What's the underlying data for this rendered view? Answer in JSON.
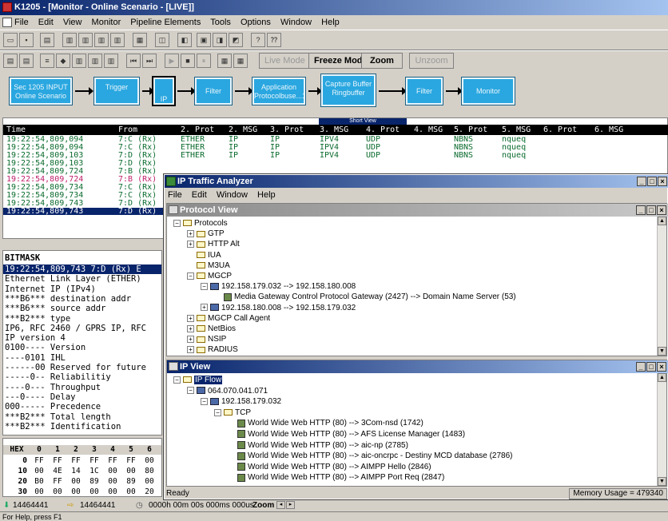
{
  "window": {
    "title": "K1205 - [Monitor - Online Scenario - [LIVE]]"
  },
  "menu": [
    "File",
    "Edit",
    "View",
    "Monitor",
    "Pipeline Elements",
    "Tools",
    "Options",
    "Window",
    "Help"
  ],
  "toolbar3": {
    "live_mode": "Live Mode",
    "freeze_mode": "Freeze Mode",
    "zoom": "Zoom",
    "unzoom": "Unzoom"
  },
  "pipeline": [
    {
      "label": "Sec 1205 INPUT Online Scenario"
    },
    {
      "label": "Trigger"
    },
    {
      "label": "IP"
    },
    {
      "label": "Filter"
    },
    {
      "label": "Application Protocolbuse...1"
    },
    {
      "label": "Capture Buffer Ringbuffer"
    },
    {
      "label": "Filter"
    },
    {
      "label": "Monitor"
    }
  ],
  "grid": {
    "short_view": "Short View",
    "headers": [
      "Time",
      "From",
      "2. Prot",
      "2. MSG",
      "3. Prot",
      "3. MSG",
      "4. Prot",
      "4. MSG",
      "5. Prot",
      "5. MSG",
      "6. Prot",
      "6. MSG"
    ],
    "rows": [
      {
        "time": "19:22:54,809,094",
        "from": "7:C (Rx)",
        "p2": "ETHER",
        "m2": "IP",
        "p3": "IP",
        "m3": "IPV4",
        "p4": "UDP",
        "m4": "",
        "p5": "NBNS",
        "m5": "nqueq",
        "style": "green"
      },
      {
        "time": "19:22:54,809,094",
        "from": "7:C (Rx)",
        "p2": "ETHER",
        "m2": "IP",
        "p3": "IP",
        "m3": "IPV4",
        "p4": "UDP",
        "m4": "",
        "p5": "NBNS",
        "m5": "nqueq",
        "style": "green"
      },
      {
        "time": "19:22:54,809,103",
        "from": "7:D (Rx)",
        "p2": "ETHER",
        "m2": "IP",
        "p3": "IP",
        "m3": "IPV4",
        "p4": "UDP",
        "m4": "",
        "p5": "NBNS",
        "m5": "nqueq",
        "style": "green"
      },
      {
        "time": "19:22:54,809,103",
        "from": "7:D (Rx)",
        "p2": "",
        "m2": "",
        "p3": "",
        "m3": "",
        "p4": "",
        "m4": "",
        "p5": "",
        "m5": "",
        "style": "green"
      },
      {
        "time": "19:22:54,809,724",
        "from": "7:B (Rx)",
        "p2": "",
        "m2": "",
        "p3": "",
        "m3": "",
        "p4": "",
        "m4": "",
        "p5": "",
        "m5": "",
        "style": "green"
      },
      {
        "time": "19:22:54,809,724",
        "from": "7:B (Rx)",
        "p2": "",
        "m2": "",
        "p3": "",
        "m3": "",
        "p4": "",
        "m4": "",
        "p5": "",
        "m5": "",
        "style": "mag"
      },
      {
        "time": "19:22:54,809,734",
        "from": "7:C (Rx)",
        "p2": "",
        "m2": "",
        "p3": "",
        "m3": "",
        "p4": "",
        "m4": "",
        "p5": "",
        "m5": "",
        "style": "green"
      },
      {
        "time": "19:22:54,809,734",
        "from": "7:C (Rx)",
        "p2": "",
        "m2": "",
        "p3": "",
        "m3": "",
        "p4": "",
        "m4": "",
        "p5": "",
        "m5": "",
        "style": "green"
      },
      {
        "time": "19:22:54,809,743",
        "from": "7:D (Rx)",
        "p2": "",
        "m2": "",
        "p3": "",
        "m3": "",
        "p4": "",
        "m4": "",
        "p5": "",
        "m5": "",
        "style": "green"
      },
      {
        "time": "19:22:54,809,743",
        "from": "7:D (Rx)",
        "p2": "",
        "m2": "",
        "p3": "",
        "m3": "",
        "p4": "",
        "m4": "",
        "p5": "",
        "m5": "",
        "style": "sel"
      }
    ]
  },
  "bitmask": {
    "title": "BITMASK",
    "lines": [
      "19:22:54,809,743  7:D (Rx)  E",
      "Ethernet Link Layer (ETHER)",
      "Internet IP (IPv4)",
      "***B6***  destination addr",
      "***B6***  source addr",
      "***B2***  type",
      "IP6, RFC 2460 / GPRS IP, RFC",
      "IP version 4",
      "0100----  Version",
      "----0101  IHL",
      "------00  Reserved for future",
      "-----0--  Reliabilitiy",
      "----0---  Throughput",
      "---0----  Delay",
      "000-----  Precedence",
      "***B2***  Total length",
      "***B2***  Identification"
    ]
  },
  "hex": {
    "header": [
      "HEX",
      "0",
      "1",
      "2",
      "3",
      "4",
      "5",
      "6"
    ],
    "rows": [
      [
        "0",
        "FF",
        "FF",
        "FF",
        "FF",
        "FF",
        "FF",
        "00"
      ],
      [
        "10",
        "00",
        "4E",
        "14",
        "1C",
        "00",
        "00",
        "80"
      ],
      [
        "20",
        "B0",
        "FF",
        "00",
        "89",
        "00",
        "89",
        "00"
      ],
      [
        "30",
        "00",
        "00",
        "00",
        "00",
        "00",
        "00",
        "20"
      ]
    ]
  },
  "status": {
    "count1": "14464441",
    "count2": "14464441",
    "duration": "0000h 00m 00s 000ms 000us",
    "zoom": "Zoom",
    "help": "For Help, press F1"
  },
  "ipta": {
    "title": "IP Traffic Analyzer",
    "menu": [
      "File",
      "Edit",
      "Window",
      "Help"
    ],
    "protocol_view": {
      "title": "Protocol View",
      "nodes": [
        {
          "label": "Protocols",
          "level": 0,
          "toggle": "−",
          "icon": "folder"
        },
        {
          "label": "GTP",
          "level": 1,
          "toggle": "+",
          "icon": "folder"
        },
        {
          "label": "HTTP Alt",
          "level": 1,
          "toggle": "+",
          "icon": "folder"
        },
        {
          "label": "IUA",
          "level": 1,
          "toggle": "",
          "icon": "folder"
        },
        {
          "label": "M3UA",
          "level": 1,
          "toggle": "",
          "icon": "folder"
        },
        {
          "label": "MGCP",
          "level": 1,
          "toggle": "−",
          "icon": "folder"
        },
        {
          "label": "192.158.179.032 --> 192.158.180.008",
          "level": 2,
          "toggle": "−",
          "icon": "pc"
        },
        {
          "label": "Media Gateway Control Protocol Gateway (2427) --> Domain Name Server (53)",
          "level": 3,
          "toggle": "",
          "icon": "www"
        },
        {
          "label": "192.158.180.008 --> 192.158.179.032",
          "level": 2,
          "toggle": "+",
          "icon": "pc"
        },
        {
          "label": "MGCP Call Agent",
          "level": 1,
          "toggle": "+",
          "icon": "folder"
        },
        {
          "label": "NetBios",
          "level": 1,
          "toggle": "+",
          "icon": "folder"
        },
        {
          "label": "NSIP",
          "level": 1,
          "toggle": "+",
          "icon": "folder"
        },
        {
          "label": "RADIUS",
          "level": 1,
          "toggle": "+",
          "icon": "folder"
        }
      ]
    },
    "ip_view": {
      "title": "IP View",
      "nodes": [
        {
          "label": "IP Flow",
          "level": 0,
          "toggle": "−",
          "icon": "folder",
          "selected": true
        },
        {
          "label": "064.070.041.071",
          "level": 1,
          "toggle": "−",
          "icon": "pc"
        },
        {
          "label": "192.158.179.032",
          "level": 2,
          "toggle": "−",
          "icon": "pc"
        },
        {
          "label": "TCP",
          "level": 3,
          "toggle": "−",
          "icon": "folder"
        },
        {
          "label": "World Wide Web HTTP (80) --> 3Com-nsd (1742)",
          "level": 4,
          "toggle": "",
          "icon": "www"
        },
        {
          "label": "World Wide Web HTTP (80) --> AFS License Manager (1483)",
          "level": 4,
          "toggle": "",
          "icon": "www"
        },
        {
          "label": "World Wide Web HTTP (80) --> aic-np (2785)",
          "level": 4,
          "toggle": "",
          "icon": "www"
        },
        {
          "label": "World Wide Web HTTP (80) --> aic-oncrpc - Destiny MCD database (2786)",
          "level": 4,
          "toggle": "",
          "icon": "www"
        },
        {
          "label": "World Wide Web HTTP (80) --> AIMPP Hello (2846)",
          "level": 4,
          "toggle": "",
          "icon": "www"
        },
        {
          "label": "World Wide Web HTTP (80) --> AIMPP Port Req (2847)",
          "level": 4,
          "toggle": "",
          "icon": "www"
        }
      ]
    },
    "status": {
      "ready": "Ready",
      "memory": "Memory Usage = 479340"
    }
  }
}
